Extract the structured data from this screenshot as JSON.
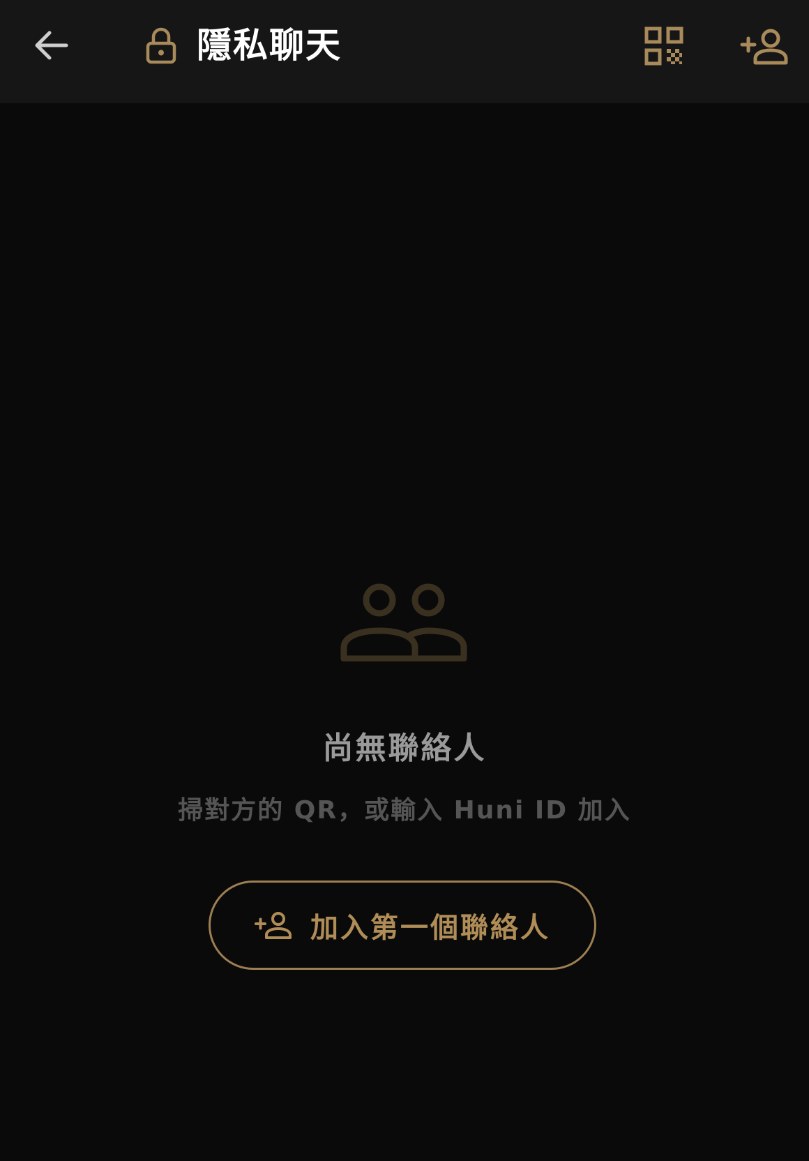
{
  "header": {
    "title": "隱私聊天",
    "back_icon": "arrow-left-icon",
    "lock_icon": "lock-icon",
    "qr_icon": "qr-code-icon",
    "add_contact_icon": "person-add-icon"
  },
  "empty_state": {
    "icon": "contacts-icon",
    "title": "尚無聯絡人",
    "subtitle": "掃對方的 QR，或輸入 Huni ID 加入",
    "button_label": "加入第一個聯絡人",
    "button_icon": "person-add-icon"
  },
  "colors": {
    "background": "#0a0a0a",
    "header_background": "#161616",
    "accent": "#b08d57",
    "title_text": "#ffffff",
    "empty_title_text": "#9a9a9a",
    "empty_subtitle_text": "#555555"
  }
}
